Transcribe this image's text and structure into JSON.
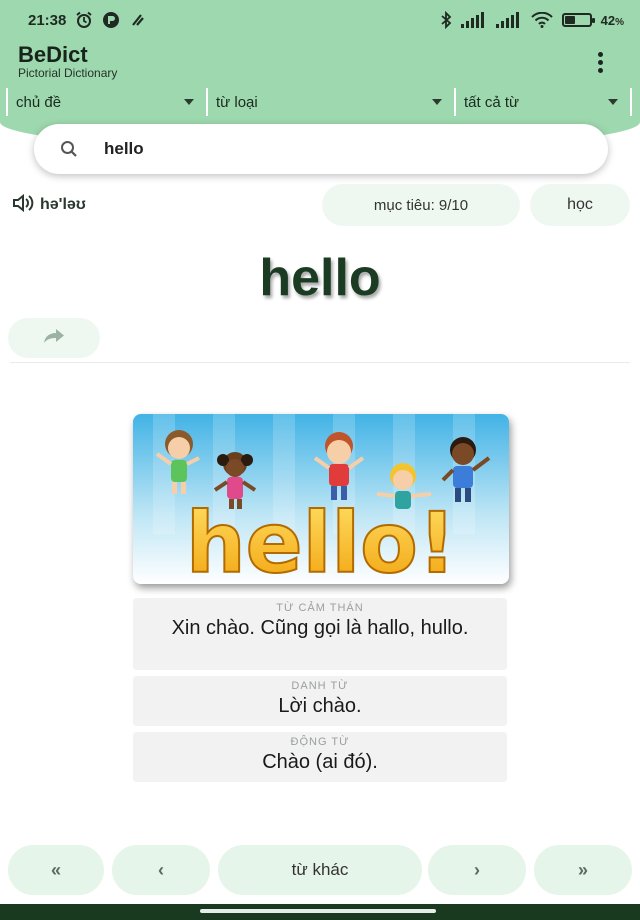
{
  "status_bar": {
    "time": "21:38",
    "battery_percent": "42",
    "battery_unit": "%",
    "battery_level": 0.42
  },
  "app": {
    "title": "BeDict",
    "subtitle": "Pictorial Dictionary"
  },
  "filters": [
    {
      "label": "chủ đề"
    },
    {
      "label": "từ loại"
    },
    {
      "label": "tất cả từ"
    }
  ],
  "search": {
    "value": "hello"
  },
  "pronunciation": "hə'ləʊ",
  "goal_label": "mục tiêu: 9/10",
  "learn_label": "học",
  "word": "hello",
  "image_text": "hello!",
  "definitions": [
    {
      "pos": "TỪ CẢM THÁN",
      "text": "Xin chào. Cũng gọi là hallo, hullo."
    },
    {
      "pos": "DANH TỪ",
      "text": "Lời chào."
    },
    {
      "pos": "ĐỘNG TỪ",
      "text": "Chào (ai đó)."
    }
  ],
  "nav": {
    "first": "«",
    "prev": "‹",
    "other": "từ khác",
    "next": "›",
    "last": "»"
  },
  "colors": {
    "header": "#9ed8ae",
    "pill": "#eef8f1",
    "word": "#1c3b23",
    "bottom_bar": "#1a3a1f"
  }
}
